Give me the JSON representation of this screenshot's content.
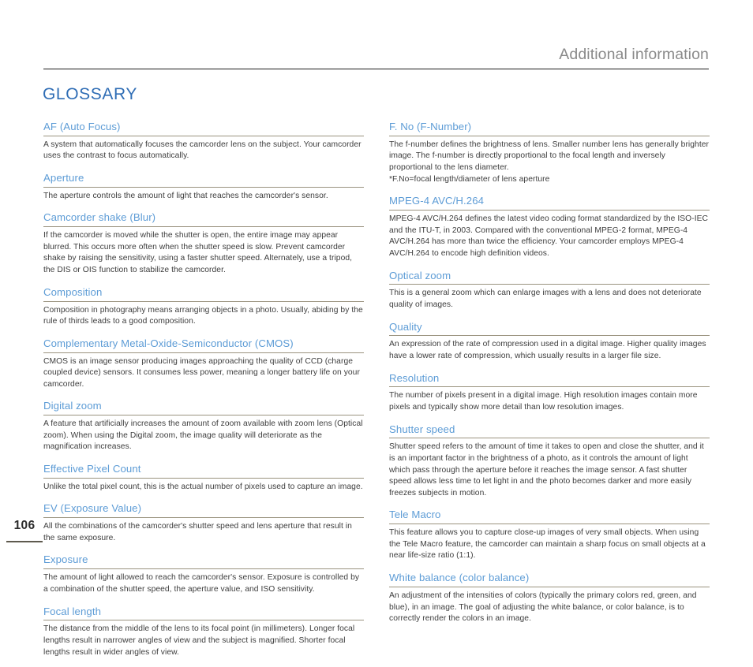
{
  "header": {
    "title": "Additional information"
  },
  "section": {
    "title": "GLOSSARY"
  },
  "page": {
    "number": "106"
  },
  "colors": {
    "section_title_blue": "#2f6db5",
    "term_blue": "#5d9cd6",
    "header_gray": "#8a8a8a",
    "rule_tan": "#9a937f",
    "header_rule": "#1b1b1b",
    "page_number_rule": "#5e5a4e",
    "body_text": "#3d3d3d"
  },
  "left_column": [
    {
      "term": "AF (Auto Focus)",
      "definition": "A system that automatically focuses the camcorder lens on the subject. Your camcorder uses the contrast to focus automatically."
    },
    {
      "term": "Aperture",
      "definition": "The aperture controls the amount of light that reaches the camcorder's sensor."
    },
    {
      "term": "Camcorder shake (Blur)",
      "definition": "If the camcorder is moved while the shutter is open, the entire image may appear blurred. This occurs more often when the shutter speed is slow. Prevent camcorder shake by raising the sensitivity, using a faster shutter speed. Alternately, use a tripod, the DIS or OIS function to stabilize the camcorder."
    },
    {
      "term": "Composition",
      "definition": "Composition in photography means arranging objects in a photo. Usually, abiding by the rule of thirds leads to a good composition."
    },
    {
      "term": "Complementary Metal-Oxide-Semiconductor (CMOS)",
      "definition": "CMOS is an image sensor producing images approaching the quality of CCD (charge coupled device) sensors. It consumes less power, meaning a longer battery life on your camcorder."
    },
    {
      "term": "Digital zoom",
      "definition": "A feature that artificially increases the amount of zoom available with zoom lens (Optical zoom). When using the Digital zoom, the image quality will deteriorate as the magnification increases."
    },
    {
      "term": "Effective Pixel Count",
      "definition": "Unlike the total pixel count, this is the actual number of pixels used to capture an image."
    },
    {
      "term": "EV (Exposure Value)",
      "definition": "All the combinations of the camcorder's shutter speed and lens aperture that result in the same exposure."
    },
    {
      "term": "Exposure",
      "definition": "The amount of light allowed to reach the camcorder's sensor. Exposure is controlled by a combination of the shutter speed, the aperture value, and ISO sensitivity."
    },
    {
      "term": "Focal length",
      "definition": "The distance from the middle of the lens to its focal point (in millimeters). Longer focal lengths result in narrower angles of view and the subject is magnified. Shorter focal lengths result in wider angles of view."
    }
  ],
  "right_column": [
    {
      "term": "F. No (F-Number)",
      "definition": "The f-number defines the brightness of lens. Smaller number lens has generally brighter image. The f-number is directly proportional to the focal length and inversely proportional to the lens diameter.\n*F.No=focal length/diameter of lens aperture"
    },
    {
      "term": "MPEG-4 AVC/H.264",
      "definition": "MPEG-4 AVC/H.264 defines the latest video coding format standardized by the ISO-IEC and the ITU-T, in 2003. Compared with the conventional MPEG-2 format, MPEG-4 AVC/H.264 has more than twice the efficiency. Your camcorder employs MPEG-4 AVC/H.264 to encode high definition videos."
    },
    {
      "term": "Optical zoom",
      "definition": "This is a general zoom which can enlarge images with a lens and does not deteriorate quality of images."
    },
    {
      "term": "Quality",
      "definition": "An expression of the rate of compression used in a digital image. Higher quality images have a lower rate of compression, which usually results in a larger file size."
    },
    {
      "term": "Resolution",
      "definition": "The number of pixels present in a digital image. High resolution images contain more pixels and typically show more detail than low resolution images."
    },
    {
      "term": "Shutter speed",
      "definition": "Shutter speed refers to the amount of time it takes to open and close the shutter, and it is an important factor in the brightness of a photo, as it controls the amount of light which pass through the aperture before it reaches the image sensor. A fast shutter speed allows less time to let light in and the photo becomes darker and more easily freezes subjects in motion."
    },
    {
      "term": "Tele Macro",
      "definition": "This feature allows you to capture close-up images of very small objects. When using the Tele Macro feature, the camcorder can maintain a sharp focus on small objects at a near life-size ratio (1:1)."
    },
    {
      "term": "White balance (color balance)",
      "definition": "An adjustment of the intensities of colors (typically the primary colors red, green, and blue), in an image. The goal of adjusting the white balance, or color balance, is to correctly render the colors in an image."
    }
  ]
}
